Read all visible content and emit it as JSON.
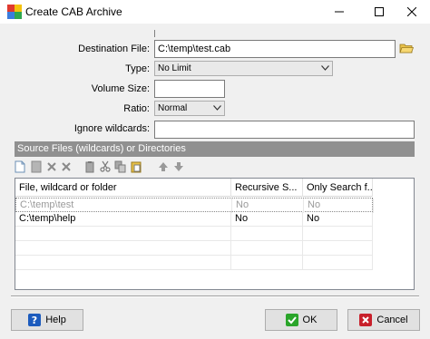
{
  "window": {
    "title": "Create CAB Archive",
    "icon": "winrar-style-app-icon"
  },
  "form": {
    "destination_label": "Destination File:",
    "destination_value": "C:\\temp\\test.cab",
    "type_label": "Type:",
    "type_value": "No Limit",
    "volume_label": "Volume Size:",
    "volume_value": "",
    "ratio_label": "Ratio:",
    "ratio_value": "Normal",
    "ignore_label": "Ignore wildcards:",
    "ignore_value": ""
  },
  "section": {
    "header": "Source Files (wildcards) or Directories"
  },
  "grid": {
    "columns": [
      "File, wildcard or folder",
      "Recursive S...",
      "Only Search f..."
    ],
    "rows": [
      {
        "file": "C:\\temp\\test",
        "recursive": "No",
        "only_search": "No",
        "dimmed": true
      },
      {
        "file": "C:\\temp\\help",
        "recursive": "No",
        "only_search": "No",
        "dimmed": false
      }
    ]
  },
  "buttons": {
    "help": "Help",
    "ok": "OK",
    "cancel": "Cancel"
  },
  "colors": {
    "section_header_bg": "#909090",
    "help_icon": "#1c5bbd",
    "ok_icon": "#2aa52a",
    "cancel_icon": "#c8202b"
  }
}
